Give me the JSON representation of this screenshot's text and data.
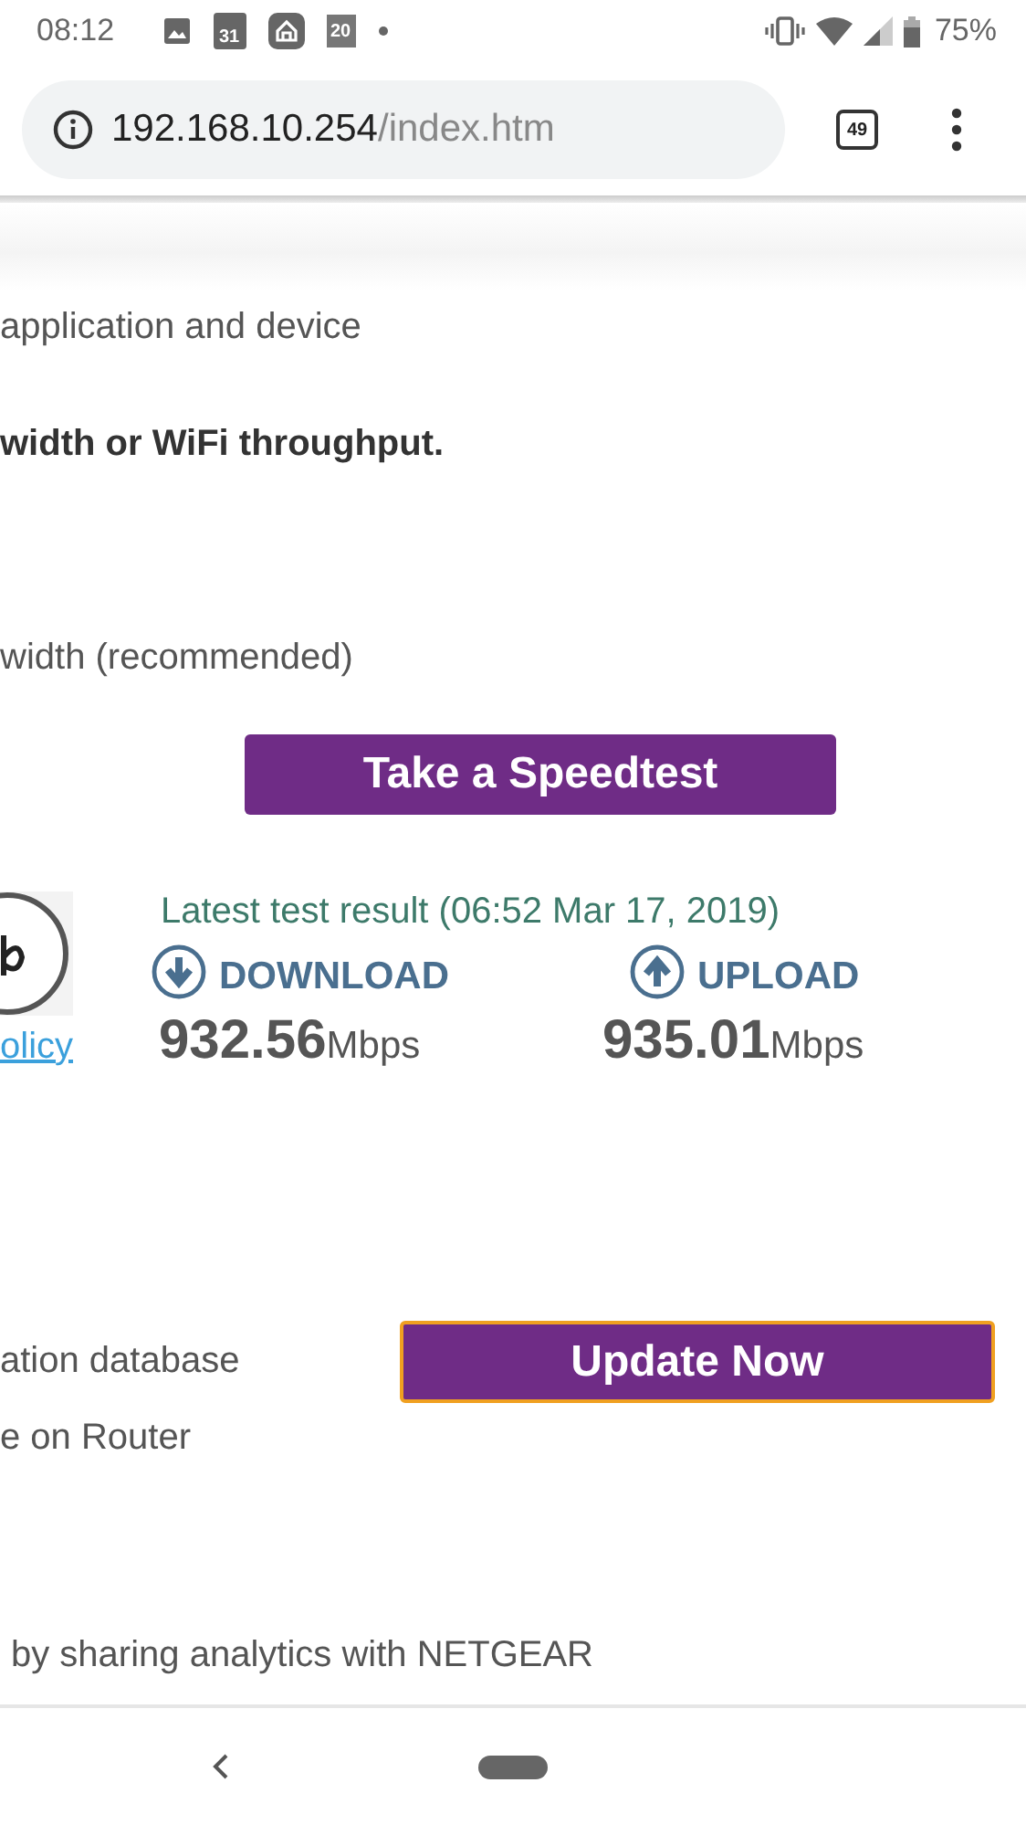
{
  "status_bar": {
    "time": "08:12",
    "calendar_day": "31",
    "date_badge": "20",
    "battery": "75%"
  },
  "browser": {
    "host": "192.168.10.254",
    "path": "/index.htm",
    "tab_count": "49"
  },
  "page": {
    "line_1": "application and device",
    "line_2": "width or WiFi throughput.",
    "line_3": "width (recommended)",
    "speedtest_button": "Take a Speedtest",
    "policy_link": "olicy",
    "result_title": "Latest test result (06:52 Mar 17, 2019)",
    "results": [
      {
        "kind": "download",
        "label": "DOWNLOAD",
        "value": "932.56",
        "unit": "Mbps"
      },
      {
        "kind": "upload",
        "label": "UPLOAD",
        "value": "935.01",
        "unit": "Mbps"
      }
    ],
    "line_4": "ation database",
    "update_button": "Update Now",
    "line_5": "e on Router",
    "line_6": "by sharing analytics with NETGEAR"
  }
}
